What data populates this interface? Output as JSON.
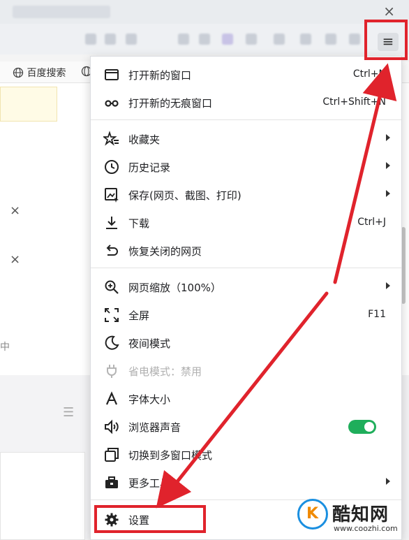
{
  "window": {
    "close_glyph": "×"
  },
  "toolbar": {
    "menu_glyph": "≡"
  },
  "bookmarks": [
    {
      "label": "百度搜索",
      "icon": "globe-icon"
    }
  ],
  "page": {
    "close_glyph": "×",
    "partial_text": "中"
  },
  "menu": {
    "items": [
      {
        "label": "打开新的窗口",
        "shortcut": "Ctrl+N",
        "icon": "new-window-icon"
      },
      {
        "label": "打开新的无痕窗口",
        "shortcut": "Ctrl+Shift+N",
        "icon": "incognito-icon"
      },
      {
        "label": "收藏夹",
        "submenu": true,
        "icon": "favorites-icon"
      },
      {
        "label": "历史记录",
        "submenu": true,
        "icon": "history-icon"
      },
      {
        "label": "保存(网页、截图、打印)",
        "submenu": true,
        "icon": "save-icon"
      },
      {
        "label": "下载",
        "shortcut": "Ctrl+J",
        "icon": "download-icon"
      },
      {
        "label": "恢复关闭的网页",
        "icon": "restore-icon"
      },
      {
        "label": "网页缩放（100%）",
        "submenu": true,
        "icon": "zoom-icon"
      },
      {
        "label": "全屏",
        "shortcut": "F11",
        "icon": "fullscreen-icon"
      },
      {
        "label": "夜间模式",
        "icon": "moon-icon"
      },
      {
        "label": "省电模式：禁用",
        "disabled": true,
        "icon": "power-saving-icon"
      },
      {
        "label": "字体大小",
        "icon": "font-size-icon"
      },
      {
        "label": "浏览器声音",
        "toggle": true,
        "toggle_on": true,
        "icon": "sound-icon"
      },
      {
        "label": "切换到多窗口模式",
        "icon": "multi-window-icon"
      },
      {
        "label": "更多工具",
        "submenu": true,
        "icon": "toolbox-icon"
      },
      {
        "label": "设置",
        "icon": "gear-icon"
      }
    ]
  },
  "colors": {
    "annotation_red": "#e0232c",
    "toggle_green": "#1fae5b",
    "watermark_blue": "#1a8fe0",
    "watermark_orange": "#f08a00"
  },
  "watermark": {
    "name": "酷知网",
    "url": "www.coozhi.com",
    "logo_letter": "K"
  }
}
